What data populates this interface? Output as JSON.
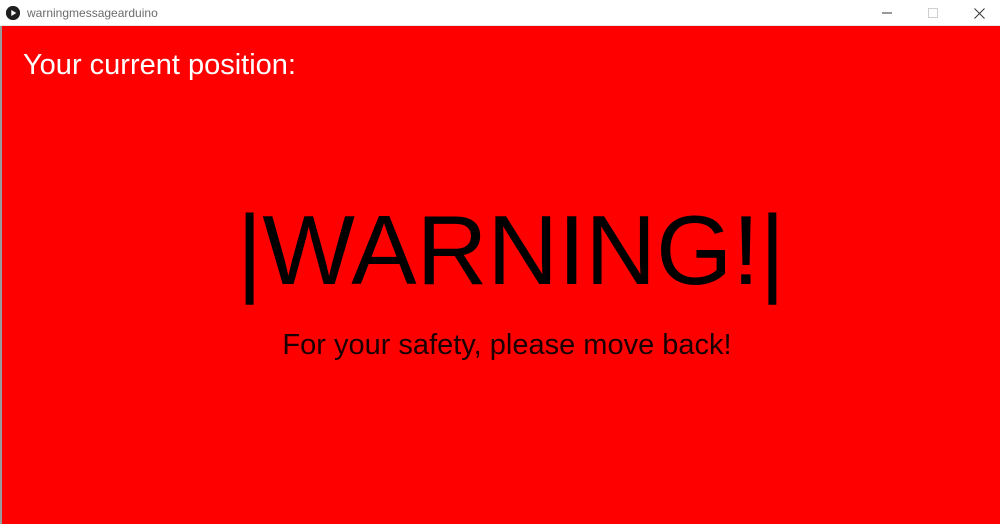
{
  "window": {
    "title": "warningmessagearduino",
    "icon": "play-icon",
    "controls": [
      "minimize-icon",
      "maximize-icon",
      "close-icon"
    ]
  },
  "canvas": {
    "background_color": "#ff0000",
    "position_label": "Your current position:",
    "warning_heading": "|WARNING!|",
    "safety_message": "For your safety, please move back!"
  },
  "colors": {
    "position_label": "#ffffff",
    "warning_text": "#000000"
  }
}
